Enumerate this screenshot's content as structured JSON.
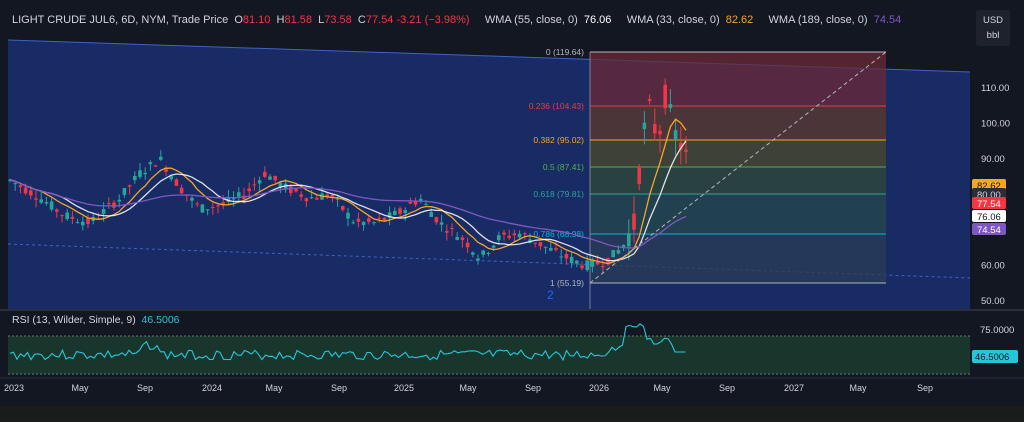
{
  "legend": {
    "symbol": "LIGHT CRUDE JUL6, 6D, NYM, Trade Price",
    "o_label": "O",
    "o_value": "81.10",
    "h_label": "H",
    "h_value": "81.58",
    "l_label": "L",
    "l_value": "73.58",
    "c_label": "C",
    "c_value": "77.54",
    "change": "-3.21 (−3.98%)",
    "wma55_label": "WMA (55, close, 0)",
    "wma55_value": "76.06",
    "wma33_label": "WMA (33, close, 0)",
    "wma33_value": "82.62",
    "wma189_label": "WMA (189, close, 0)",
    "wma189_value": "74.54"
  },
  "unit": {
    "currency": "USD",
    "unit": "bbl"
  },
  "price_axis": {
    "ticks": [
      "110.00",
      "100.00",
      "90.00",
      "80.00",
      "70.00",
      "60.00",
      "50.00"
    ]
  },
  "price_tags": [
    {
      "text": "82.62",
      "color": "#f5a623",
      "text_color": "#131722"
    },
    {
      "text": "80.00",
      "color": "#2a2e39",
      "text_color": "#d1d4dc"
    },
    {
      "text": "77.54",
      "color": "#f23645",
      "text_color": "#ffffff"
    },
    {
      "text": "76.06",
      "color": "#ffffff",
      "text_color": "#131722"
    },
    {
      "text": "74.54",
      "color": "#7e57c2",
      "text_color": "#ffffff"
    }
  ],
  "fib_levels": [
    {
      "label": "0 (119.64)",
      "color": "#b2b5be"
    },
    {
      "label": "0.236 (104.43)",
      "color": "#f23645"
    },
    {
      "label": "0.382 (95.02)",
      "color": "#f5a623"
    },
    {
      "label": "0.5 (87.41)",
      "color": "#4caf50"
    },
    {
      "label": "0.618 (79.81)",
      "color": "#26a69a"
    },
    {
      "label": "0.786 (68.98)",
      "color": "#00bcd4"
    },
    {
      "label": "1 (55.19)",
      "color": "#b2b5be"
    }
  ],
  "wave_label": "2",
  "rsi": {
    "label": "RSI (13, Wilder, Simple, 9)",
    "value": "46.5006",
    "axis_tick": "75.0000",
    "value_tag": "46.5006"
  },
  "time_axis": {
    "labels": [
      "2023",
      "May",
      "Sep",
      "2024",
      "May",
      "Sep",
      "2025",
      "May",
      "Sep",
      "2026",
      "May",
      "Sep",
      "2027",
      "May",
      "Sep"
    ]
  },
  "colors": {
    "up": "#26a69a",
    "down": "#f23645",
    "wma33": "#f5a623",
    "wma55": "#ffffff",
    "wma189": "#7e57c2",
    "rsi": "#26c6da"
  }
}
